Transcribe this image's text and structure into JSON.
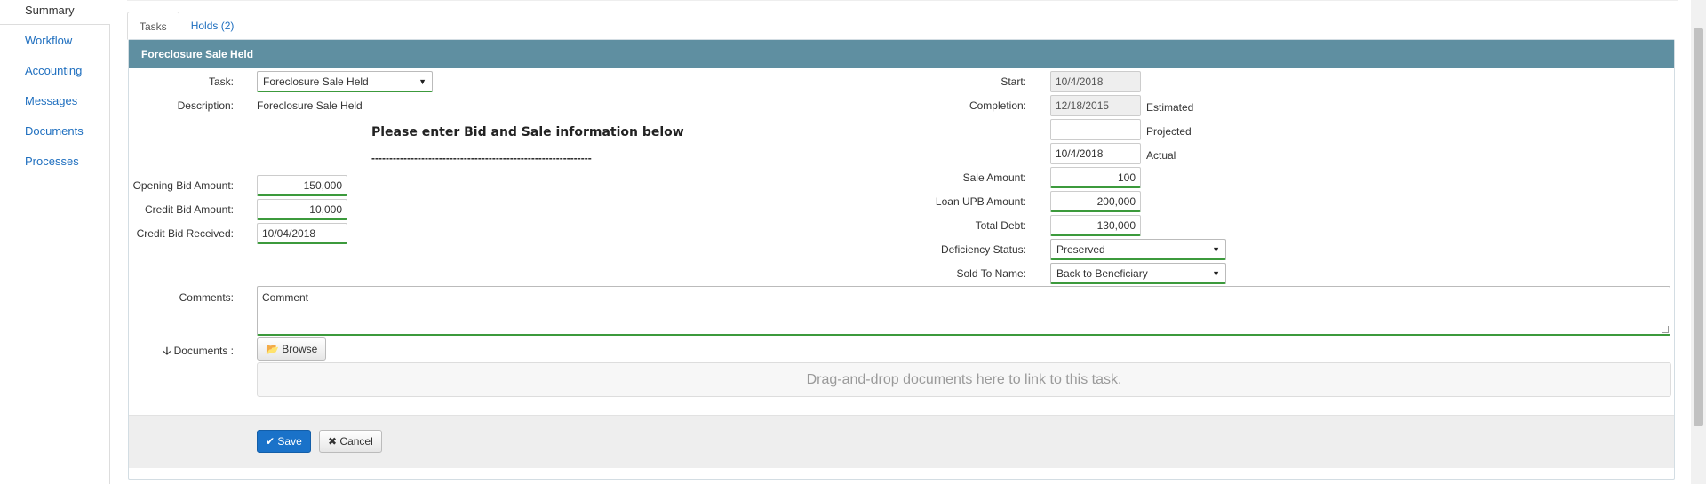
{
  "sidebar": {
    "items": [
      {
        "label": "Summary"
      },
      {
        "label": "Workflow"
      },
      {
        "label": "Accounting"
      },
      {
        "label": "Messages"
      },
      {
        "label": "Documents"
      },
      {
        "label": "Processes"
      }
    ]
  },
  "tabs": [
    {
      "label": "Tasks"
    },
    {
      "label": "Holds (2)"
    }
  ],
  "panel": {
    "title": "Foreclosure Sale Held"
  },
  "form": {
    "task_label": "Task:",
    "task_value": "Foreclosure Sale Held",
    "description_label": "Description:",
    "description_value": "Foreclosure Sale Held",
    "heading": "Please enter Bid and Sale information below",
    "dashes": "--------------------------------------------------------------",
    "opening_bid_label": "Opening Bid Amount:",
    "opening_bid_value": "150,000",
    "credit_bid_label": "Credit Bid Amount:",
    "credit_bid_value": "10,000",
    "credit_bid_received_label": "Credit Bid Received:",
    "credit_bid_received_value": "10/04/2018",
    "start_label": "Start:",
    "start_value": "10/4/2018",
    "completion_label": "Completion:",
    "completion_estimated_value": "12/18/2015",
    "estimated_label": "Estimated",
    "projected_value": "",
    "projected_label": "Projected",
    "actual_value": "10/4/2018",
    "actual_label": "Actual",
    "sale_amount_label": "Sale Amount:",
    "sale_amount_value": "100",
    "loan_upb_label": "Loan UPB Amount:",
    "loan_upb_value": "200,000",
    "total_debt_label": "Total Debt:",
    "total_debt_value": "130,000",
    "deficiency_label": "Deficiency Status:",
    "deficiency_value": "Preserved",
    "sold_to_label": "Sold To Name:",
    "sold_to_value": "Back to Beneficiary",
    "comments_label": "Comments:",
    "comments_value": "Comment",
    "documents_label": "Documents :",
    "browse_label": "Browse",
    "dropzone_text": "Drag-and-drop documents here to link to this task."
  },
  "footer": {
    "save_label": "Save",
    "cancel_label": "Cancel"
  },
  "colors": {
    "panel_header": "#5f8fa1",
    "link": "#1f6fbf",
    "primary_button": "#1a72c9",
    "valid_underline": "#3c9a3c"
  }
}
